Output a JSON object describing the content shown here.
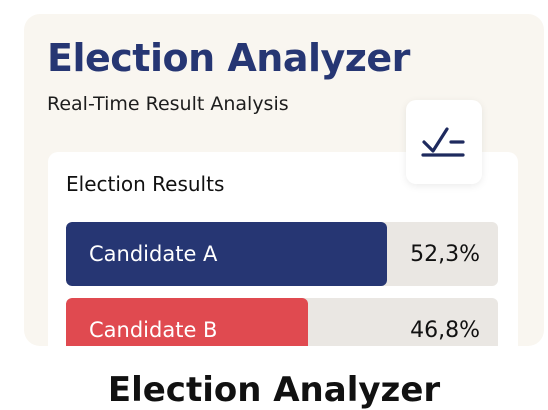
{
  "header": {
    "title": "Election Analyzer",
    "subtitle": "Real-Time Result Analysis",
    "icon": "checkmark-dash-icon"
  },
  "results": {
    "heading": "Election Results",
    "candidates": [
      {
        "name": "Candidate A",
        "percent_text": "52,3%",
        "share": 0.743,
        "color": "#263673"
      },
      {
        "name": "Candidate B",
        "percent_text": "46,8%",
        "share": 0.56,
        "color": "#e04a50"
      }
    ]
  },
  "footer": {
    "title": "Election Analyzer"
  },
  "colors": {
    "brand": "#263673",
    "accent": "#e04a50",
    "card_bg": "#f9f6f0"
  }
}
